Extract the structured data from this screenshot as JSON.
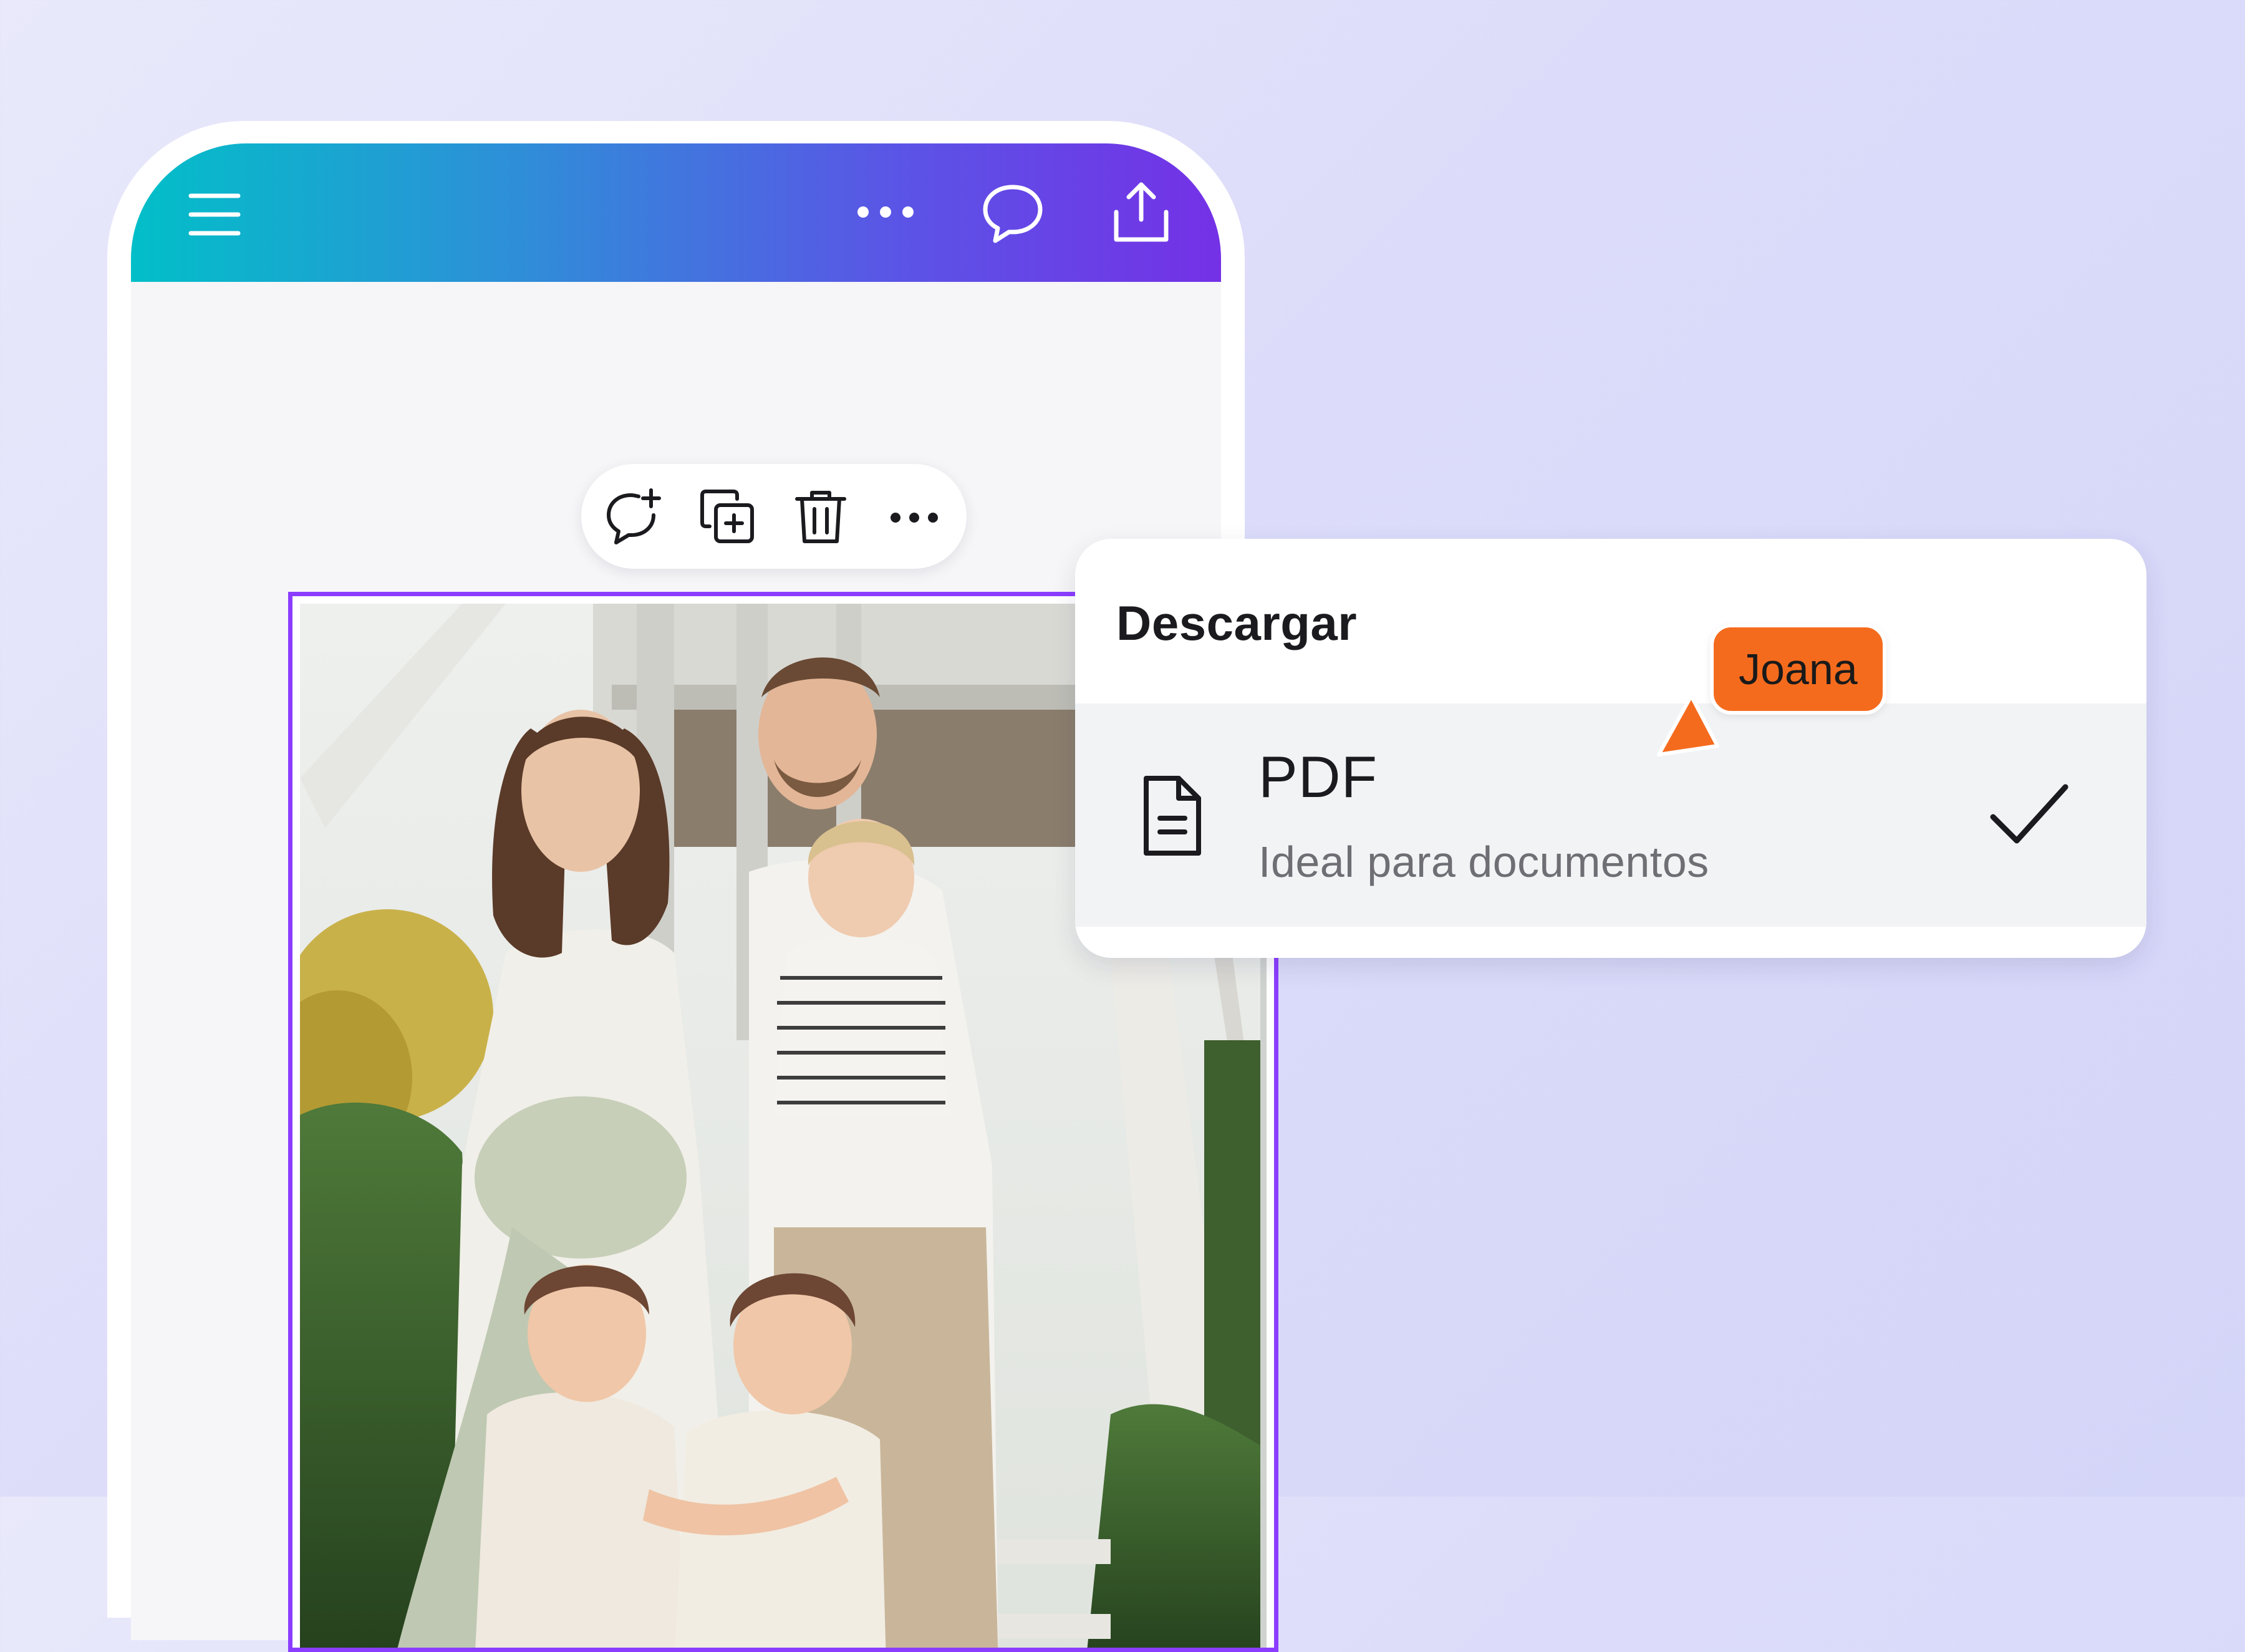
{
  "colors": {
    "accent": "#8b3dff",
    "gradient_start": "#02bfc8",
    "gradient_end": "#7431e6",
    "collaborator": "#f56b1d"
  },
  "top_bar": {
    "icons": [
      "menu-icon",
      "more-icon",
      "comment-icon",
      "share-icon"
    ]
  },
  "element_toolbar": {
    "icons": [
      "add-comment-icon",
      "duplicate-icon",
      "delete-icon",
      "more-icon"
    ]
  },
  "photo": {
    "icon": "family-photo"
  },
  "download_panel": {
    "title": "Descargar",
    "option": {
      "name": "PDF",
      "description": "Ideal para documentos",
      "icon": "document-icon",
      "selected": true
    }
  },
  "collaborator": {
    "name": "Joana"
  }
}
